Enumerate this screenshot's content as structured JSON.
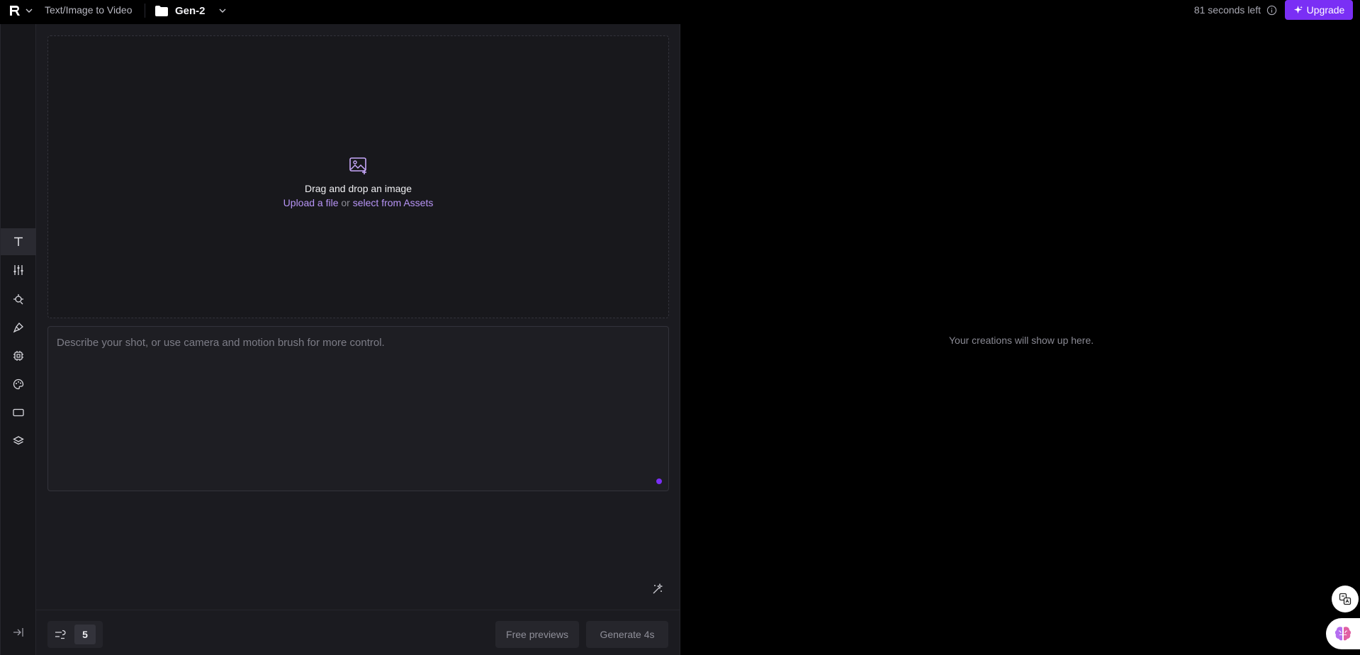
{
  "header": {
    "app_title": "Text/Image to Video",
    "project_name": "Gen-2",
    "time_left": "81 seconds left",
    "upgrade_label": "Upgrade"
  },
  "rail": {
    "items": [
      {
        "name": "text",
        "icon": "text-icon",
        "active": true
      },
      {
        "name": "settings",
        "icon": "sliders-icon",
        "active": false
      },
      {
        "name": "camera",
        "icon": "camera-motion-icon",
        "active": false
      },
      {
        "name": "motion-brush",
        "icon": "brush-icon",
        "active": false
      },
      {
        "name": "model",
        "icon": "chip-icon",
        "active": false
      },
      {
        "name": "style",
        "icon": "palette-icon",
        "active": false
      },
      {
        "name": "aspect-ratio",
        "icon": "aspect-ratio-icon",
        "active": false
      },
      {
        "name": "layers",
        "icon": "layers-icon",
        "active": false
      }
    ]
  },
  "dropzone": {
    "title": "Drag and drop an image",
    "upload_link": "Upload a file",
    "or_text": "or",
    "assets_link": "select from Assets"
  },
  "prompt": {
    "placeholder": "Describe your shot, or use camera and motion brush for more control."
  },
  "footer": {
    "count_value": "5",
    "free_previews_label": "Free previews",
    "generate_label": "Generate 4s"
  },
  "output": {
    "empty_message": "Your creations will show up here."
  },
  "colors": {
    "accent": "#7a2ff5",
    "link": "#b794f6",
    "panel_bg": "#1b1b20",
    "page_bg": "#000000"
  }
}
